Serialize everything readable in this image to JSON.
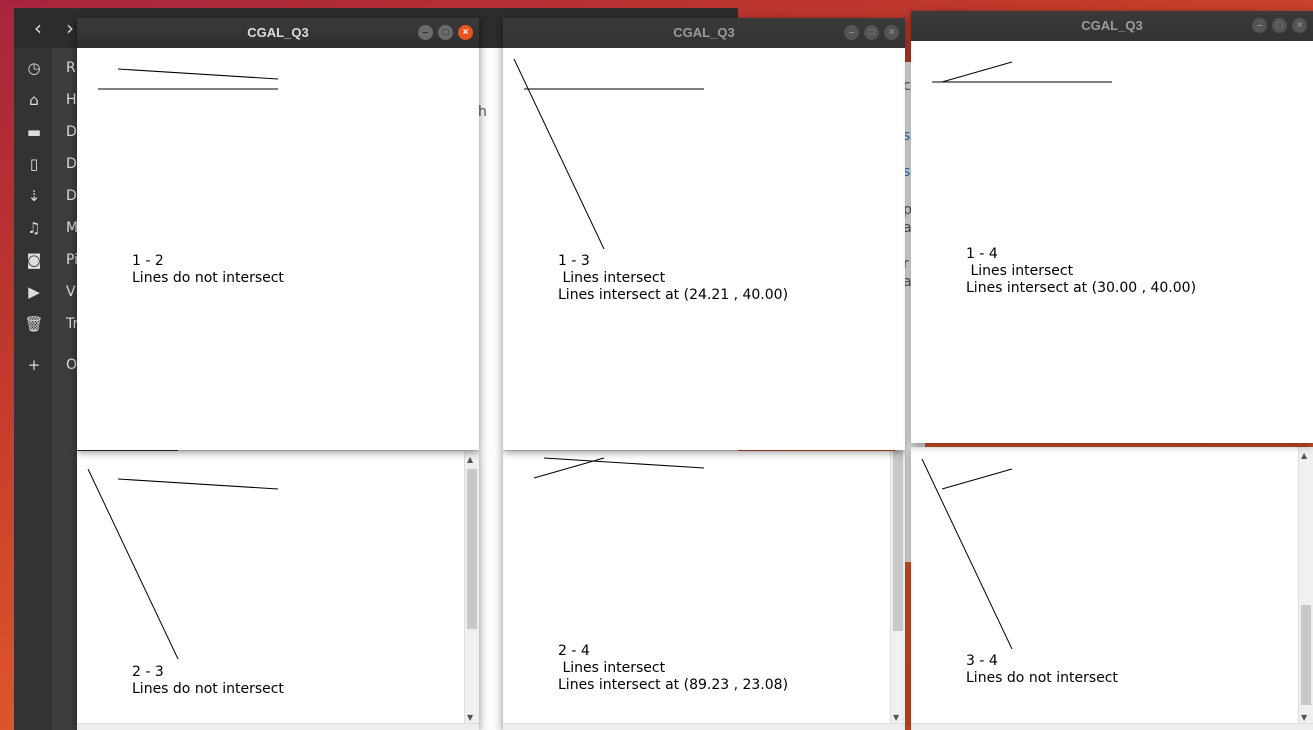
{
  "file_manager": {
    "sidebar_items": [
      {
        "icon": "clock-icon",
        "label": "R"
      },
      {
        "icon": "home-icon",
        "label": "H"
      },
      {
        "icon": "folder-icon",
        "label": "D"
      },
      {
        "icon": "document-icon",
        "label": "D"
      },
      {
        "icon": "download-icon",
        "label": "D"
      },
      {
        "icon": "music-icon",
        "label": "M"
      },
      {
        "icon": "camera-icon",
        "label": "Pi"
      },
      {
        "icon": "video-icon",
        "label": "V"
      },
      {
        "icon": "trash-icon",
        "label": "Tr"
      },
      {
        "icon": "plus-icon",
        "label": "O"
      }
    ],
    "content_fragment": "h"
  },
  "bg_window_fragments": [
    "c",
    "s",
    "s",
    "p",
    "a",
    "r",
    "a"
  ],
  "windows": [
    {
      "title": "CGAL_Q3",
      "pair": "1 - 2",
      "line1": "Lines do not intersect",
      "line2": ""
    },
    {
      "title": "CGAL_Q3",
      "pair": "1 - 3",
      "line1": " Lines intersect",
      "line2": "Lines intersect at (24.21 , 40.00)"
    },
    {
      "title": "CGAL_Q3",
      "pair": "1 - 4",
      "line1": " Lines intersect",
      "line2": "Lines intersect at (30.00 , 40.00)"
    },
    {
      "pair": "2 - 3",
      "line1": "Lines do not intersect",
      "line2": ""
    },
    {
      "pair": "2 - 4",
      "line1": " Lines intersect",
      "line2": "Lines intersect at (89.23 , 23.08)"
    },
    {
      "pair": "3 - 4",
      "line1": "Lines do not intersect",
      "line2": ""
    }
  ],
  "colors": {
    "close_button": "#e95420",
    "titlebar": "#2e2e2e"
  }
}
